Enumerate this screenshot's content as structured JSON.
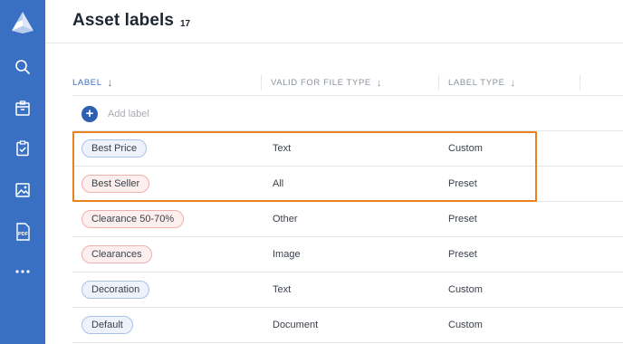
{
  "header": {
    "title": "Asset labels",
    "count": "17"
  },
  "sidebar": {
    "items": [
      {
        "name": "search",
        "icon": "search-icon"
      },
      {
        "name": "archive",
        "icon": "archive-box-icon"
      },
      {
        "name": "tasks",
        "icon": "clipboard-check-icon"
      },
      {
        "name": "images",
        "icon": "image-icon"
      },
      {
        "name": "pdf",
        "icon": "pdf-icon",
        "label": "PDF"
      },
      {
        "name": "more",
        "icon": "more-dots-icon"
      }
    ]
  },
  "table": {
    "columns": [
      {
        "label": "LABEL",
        "sort": "↓",
        "active": true
      },
      {
        "label": "VALID FOR FILE TYPE",
        "sort": "↓",
        "active": false
      },
      {
        "label": "LABEL TYPE",
        "sort": "↓",
        "active": false
      }
    ],
    "add_label": "Add label",
    "rows": [
      {
        "label": "Best Price",
        "file_type": "Text",
        "label_type": "Custom"
      },
      {
        "label": "Best Seller",
        "file_type": "All",
        "label_type": "Preset"
      },
      {
        "label": "Clearance 50-70%",
        "file_type": "Other",
        "label_type": "Preset"
      },
      {
        "label": "Clearances",
        "file_type": "Image",
        "label_type": "Preset"
      },
      {
        "label": "Decoration",
        "file_type": "Text",
        "label_type": "Custom"
      },
      {
        "label": "Default",
        "file_type": "Document",
        "label_type": "Custom"
      }
    ]
  },
  "colors": {
    "sidebar": "#3a70c3",
    "accent": "#2d5fb3",
    "highlight": "#e8821c",
    "chip_custom_border": "#a9c2e8",
    "chip_preset_border": "#efb0ab"
  }
}
